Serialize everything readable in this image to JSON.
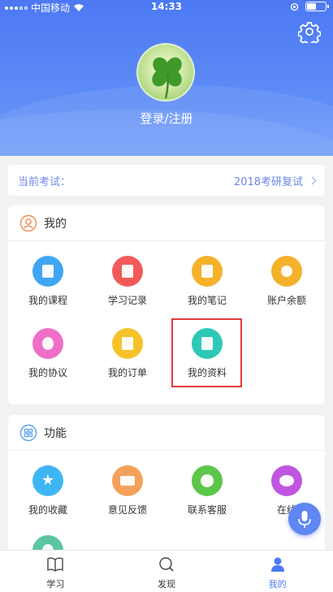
{
  "status": {
    "carrier": "中国移动",
    "time": "14:33"
  },
  "profile": {
    "login_label": "登录/注册"
  },
  "exam": {
    "label": "当前考试：",
    "value": "2018考研复试"
  },
  "mine": {
    "title": "我的",
    "items": [
      {
        "label": "我的课程",
        "color": "#3fa6f4"
      },
      {
        "label": "学习记录",
        "color": "#f25a5a"
      },
      {
        "label": "我的笔记",
        "color": "#f5b12a"
      },
      {
        "label": "账户余额",
        "color": "#f5b12a"
      },
      {
        "label": "我的协议",
        "color": "#ef6fc8"
      },
      {
        "label": "我的订单",
        "color": "#f5c22a"
      },
      {
        "label": "我的资料",
        "color": "#2ec9b6"
      }
    ]
  },
  "functions": {
    "title": "功能",
    "items": [
      {
        "label": "我的收藏",
        "color": "#3fb6f4"
      },
      {
        "label": "意见反馈",
        "color": "#f5a05a"
      },
      {
        "label": "联系客服",
        "color": "#5cc64a"
      },
      {
        "label": "在线",
        "color": "#c056e0"
      }
    ]
  },
  "tabs": [
    {
      "label": "学习",
      "icon": "book-icon"
    },
    {
      "label": "发现",
      "icon": "search-icon"
    },
    {
      "label": "我的",
      "icon": "user-icon"
    }
  ]
}
